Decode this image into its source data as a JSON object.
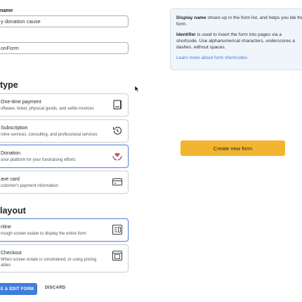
{
  "form": {
    "name_label": "name",
    "name_value": "y donation cause",
    "identifier_value": "onForm"
  },
  "type_section": {
    "heading": "type",
    "options": [
      {
        "title": "One-time payment",
        "desc": "oftware, ticket, physical goods, and settle invoices",
        "icon": "receipt-icon",
        "selected": false
      },
      {
        "title": "Subscription",
        "desc": "nline services, consulting, and professional services",
        "icon": "history-icon",
        "selected": false
      },
      {
        "title": "Donation",
        "desc": "onor platform for your fundraising efforts",
        "icon": "heart-hands-icon",
        "selected": true
      },
      {
        "title": "ave card",
        "desc": "ustomer's payment information",
        "icon": "credit-card-icon",
        "selected": false
      }
    ]
  },
  "layout_section": {
    "heading": "layout",
    "options": [
      {
        "title": "nline",
        "desc": "nough screen estate to display the entire form",
        "icon": "inline-layout-icon",
        "selected": true
      },
      {
        "title": "Checkout",
        "desc": "When screen estate is constrained, or using pricing ables",
        "icon": "checkout-layout-icon",
        "selected": false
      }
    ]
  },
  "actions": {
    "save_label": "E & EDIT FORM",
    "discard_label": "DISCARD"
  },
  "help": {
    "p1_bold": "Display name",
    "p1_text": " shows up in the form list, and helps you ide the form.",
    "p2_bold": "Identifier",
    "p2_text": " is used to insert the form into pages via a shortcode. Use alphanumerical characters, underscores a dashes, without spaces.",
    "link": "Learn more about form shortcodes"
  },
  "create_button": "Create new form",
  "colors": {
    "accent": "#3f7dde",
    "create": "#f3b530",
    "help_bg": "#f0f5fc",
    "selected_border": "#6a8fd4"
  }
}
